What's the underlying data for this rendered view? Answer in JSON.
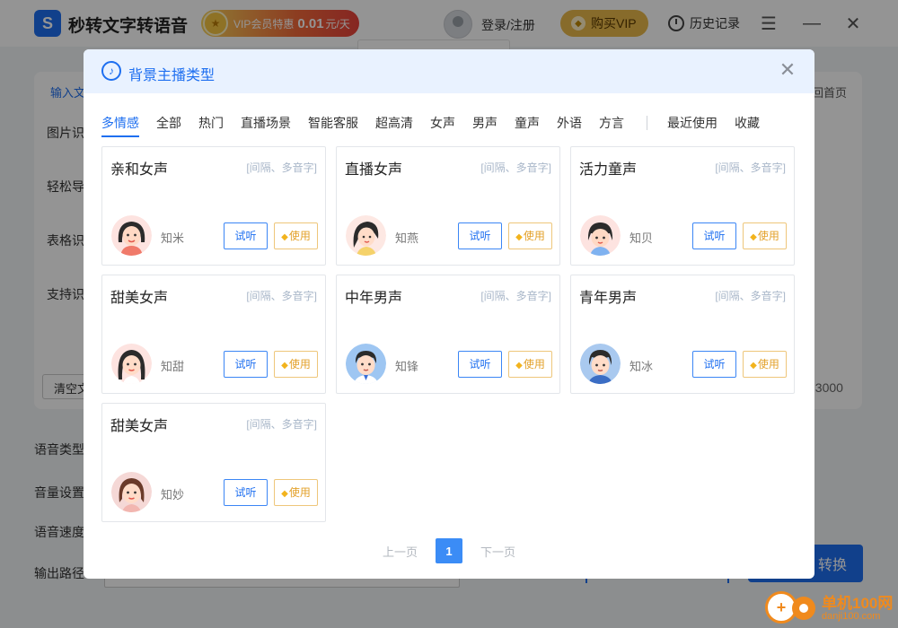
{
  "app": {
    "logo_glyph": "S",
    "title": "秒转文字转语音",
    "vip_promo_prefix": "VIP会员特惠",
    "vip_promo_price": "0.01",
    "vip_promo_suffix": "元/天",
    "login_label": "登录/注册",
    "buy_vip_label": "购买VIP",
    "history_label": "历史记录",
    "menu_glyph": "☰",
    "minimize_glyph": "—",
    "close_glyph": "✕",
    "brand_color": "#1e6ff0"
  },
  "background": {
    "tab_input": "输入文",
    "back_home": "回首页",
    "side_labels": [
      "图片识",
      "轻松导",
      "表格识",
      "支持识"
    ],
    "clear_button": "清空文",
    "char_count": "/ 3000",
    "voice_type_label": "语音类型",
    "volume_label": "音量设置",
    "speed_label": "语音速度",
    "output_path_label": "输出路径",
    "convert_button": "转换"
  },
  "modal": {
    "title": "背景主播类型",
    "tabs": [
      "多情感",
      "全部",
      "热门",
      "直播场景",
      "智能客服",
      "超高清",
      "女声",
      "男声",
      "童声",
      "外语",
      "方言",
      "最近使用",
      "收藏"
    ],
    "active_tab": "多情感",
    "cards": [
      {
        "title": "亲和女声",
        "tags": "[间隔、多音字]",
        "voice": "知米",
        "avatar": "female-avatar-1",
        "listen": "试听",
        "use": "使用"
      },
      {
        "title": "直播女声",
        "tags": "[间隔、多音字]",
        "voice": "知燕",
        "avatar": "female-avatar-2",
        "listen": "试听",
        "use": "使用"
      },
      {
        "title": "活力童声",
        "tags": "[间隔、多音字]",
        "voice": "知贝",
        "avatar": "child-avatar",
        "listen": "试听",
        "use": "使用"
      },
      {
        "title": "甜美女声",
        "tags": "[间隔、多音字]",
        "voice": "知甜",
        "avatar": "female-avatar-3",
        "listen": "试听",
        "use": "使用"
      },
      {
        "title": "中年男声",
        "tags": "[间隔、多音字]",
        "voice": "知锋",
        "avatar": "male-avatar-1",
        "listen": "试听",
        "use": "使用"
      },
      {
        "title": "青年男声",
        "tags": "[间隔、多音字]",
        "voice": "知冰",
        "avatar": "male-avatar-2",
        "listen": "试听",
        "use": "使用"
      },
      {
        "title": "甜美女声",
        "tags": "[间隔、多音字]",
        "voice": "知妙",
        "avatar": "female-avatar-4",
        "listen": "试听",
        "use": "使用"
      }
    ],
    "pagination": {
      "prev": "上一页",
      "current": "1",
      "next": "下一页"
    }
  },
  "watermark": {
    "text": "单机100网",
    "sub": "danji100.com"
  }
}
